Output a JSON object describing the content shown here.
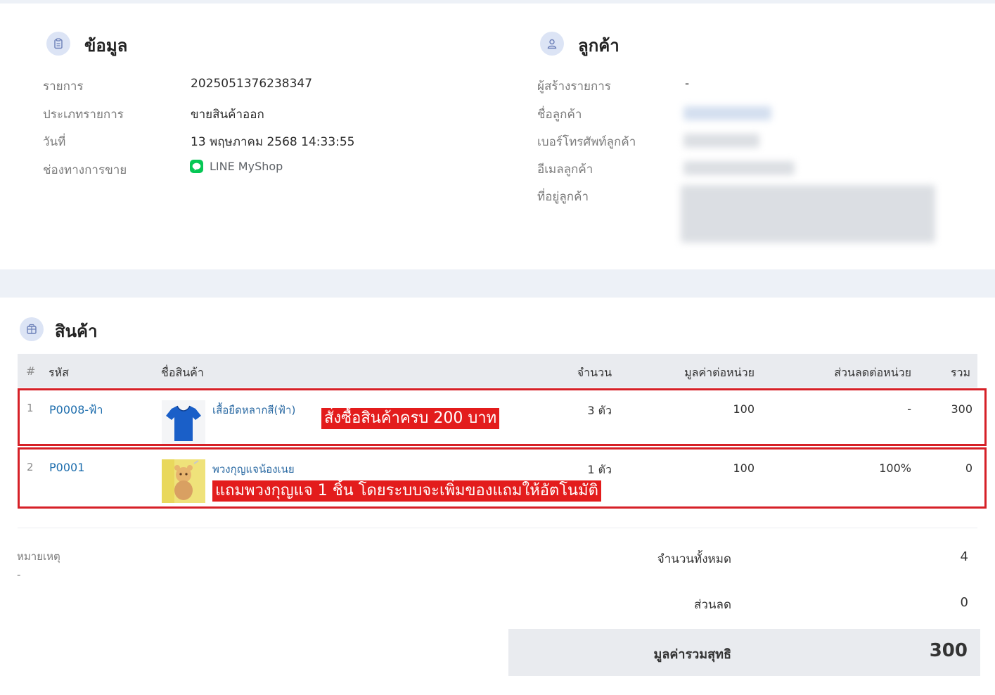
{
  "info": {
    "title": "ข้อมูล",
    "fields": [
      {
        "label": "รายการ",
        "value": "2025051376238347"
      },
      {
        "label": "ประเภทรายการ",
        "value": "ขายสินค้าออก"
      },
      {
        "label": "วันที่",
        "value": "13 พฤษภาคม 2568 14:33:55"
      },
      {
        "label": "ช่องทางการขาย",
        "value": "LINE MyShop"
      }
    ]
  },
  "customer": {
    "title": "ลูกค้า",
    "fields": [
      {
        "label": "ผู้สร้างรายการ",
        "value": "-"
      },
      {
        "label": "ชื่อลูกค้า"
      },
      {
        "label": "เบอร์โทรศัพท์ลูกค้า"
      },
      {
        "label": "อีเมลลูกค้า"
      },
      {
        "label": "ที่อยู่ลูกค้า"
      }
    ]
  },
  "products": {
    "title": "สินค้า",
    "columns": [
      "#",
      "รหัส",
      "ชื่อสินค้า",
      "จำนวน",
      "มูลค่าต่อหน่วย",
      "ส่วนลดต่อหน่วย",
      "รวม"
    ],
    "rows": [
      {
        "index": "1",
        "code": "P0008-ฟ้า",
        "name": "เสื้อยืดหลากสี(ฟ้า)",
        "qty": "3 ตัว",
        "unit_price": "100",
        "discount": "-",
        "total": "300",
        "thumb_icon": "blue-tshirt-icon",
        "promo": "สั่งซื้อสินค้าครบ 200 บาท"
      },
      {
        "index": "2",
        "code": "P0001",
        "name": "พวงกุญแจน้องเนย",
        "qty": "1 ตัว",
        "unit_price": "100",
        "discount": "100%",
        "total": "0",
        "thumb_icon": "keychain-doll-icon",
        "promo": "แถมพวงกุญแจ 1 ชิ้น โดยระบบจะเพิ่มของแถมให้อัตโนมัติ"
      }
    ],
    "accent_color": "#d62027"
  },
  "note": {
    "label": "หมายเหตุ",
    "value": "-"
  },
  "summary": {
    "total_qty_label": "จำนวนทั้งหมด",
    "total_qty": "4",
    "discount_label": "ส่วนลด",
    "discount": "0",
    "net_label": "มูลค่ารวมสุทธิ",
    "net": "300"
  }
}
